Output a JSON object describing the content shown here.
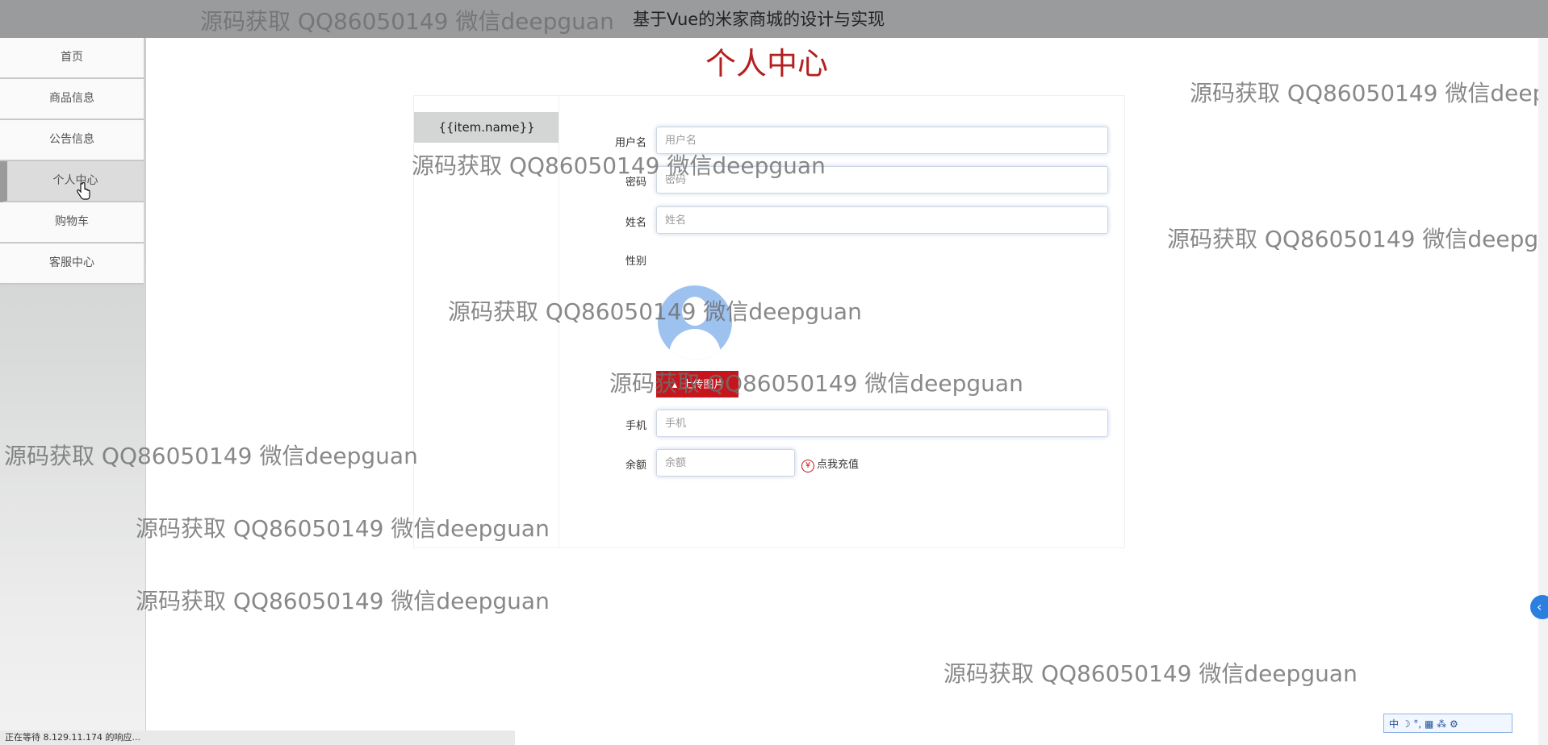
{
  "header": {
    "title": "基于Vue的米家商城的设计与实现"
  },
  "sidebar": {
    "items": [
      {
        "label": "首页"
      },
      {
        "label": "商品信息"
      },
      {
        "label": "公告信息"
      },
      {
        "label": "个人中心"
      },
      {
        "label": "购物车"
      },
      {
        "label": "客服中心"
      }
    ]
  },
  "page": {
    "title": "个人中心"
  },
  "tabs": [
    {
      "label": "{{item.name}}"
    }
  ],
  "form": {
    "username": {
      "label": "用户名",
      "placeholder": "用户名"
    },
    "password": {
      "label": "密码",
      "placeholder": "密码"
    },
    "name": {
      "label": "姓名",
      "placeholder": "姓名"
    },
    "gender": {
      "label": "性别"
    },
    "upload_label": "上传图片",
    "phone": {
      "label": "手机",
      "placeholder": "手机"
    },
    "balance": {
      "label": "余额",
      "placeholder": "余额"
    },
    "recharge_label": "点我充值"
  },
  "watermark": "源码获取 QQ86050149 微信deepguan",
  "status": {
    "text": "正在等待 8.129.11.174 的响应..."
  },
  "ime": {
    "text": "中 ☽ °, ▦ ⁂ ⚙"
  },
  "colors": {
    "accent": "#c4161c",
    "title": "#b3201f",
    "avatar": "#9ec2ef"
  }
}
